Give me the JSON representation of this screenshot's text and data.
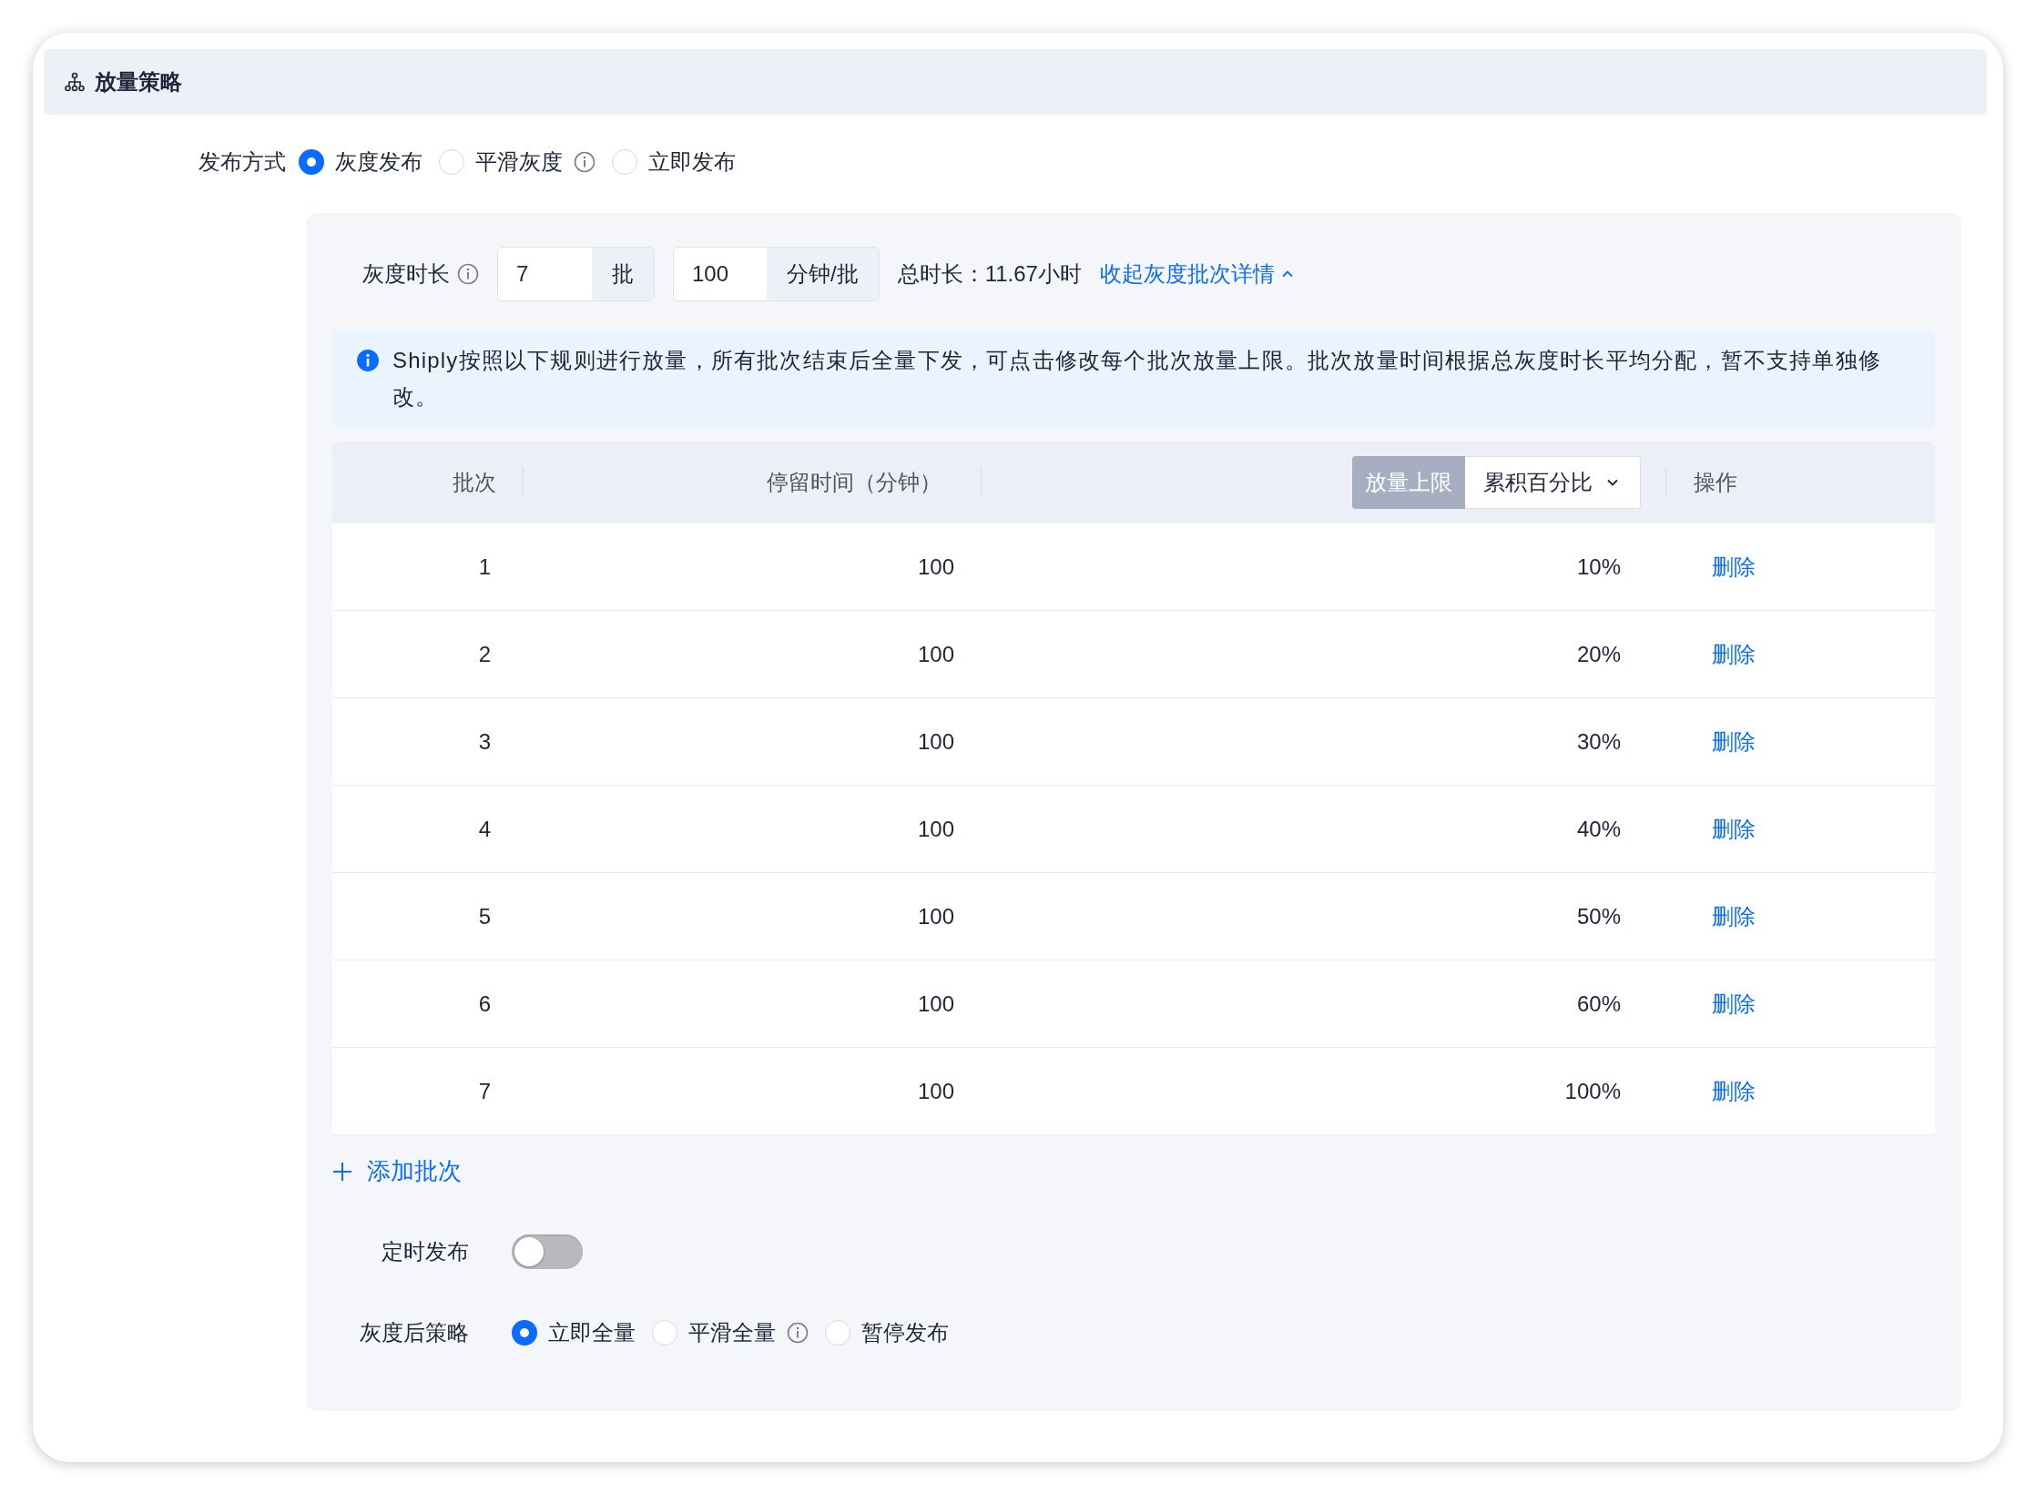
{
  "section": {
    "title": "放量策略"
  },
  "release_mode": {
    "label": "发布方式",
    "options": [
      {
        "label": "灰度发布",
        "selected": true,
        "info": false
      },
      {
        "label": "平滑灰度",
        "selected": false,
        "info": true
      },
      {
        "label": "立即发布",
        "selected": false,
        "info": false
      }
    ]
  },
  "duration": {
    "label": "灰度时长",
    "batches": {
      "value": "7",
      "unit": "批"
    },
    "minutes": {
      "value": "100",
      "unit": "分钟/批"
    },
    "total": "总时长：11.67小时",
    "toggle_link": "收起灰度批次详情"
  },
  "notice": "Shiply按照以下规则进行放量，所有批次结束后全量下发，可点击修改每个批次放量上限。批次放量时间根据总灰度时长平均分配，暂不支持单独修改。",
  "table": {
    "columns": [
      "批次",
      "停留时间（分钟）"
    ],
    "limit_header": {
      "tag": "放量上限",
      "select": "累积百分比"
    },
    "action_column": "操作",
    "rows": [
      {
        "batch": "1",
        "minutes": "100",
        "limit": "10%",
        "action": "删除"
      },
      {
        "batch": "2",
        "minutes": "100",
        "limit": "20%",
        "action": "删除"
      },
      {
        "batch": "3",
        "minutes": "100",
        "limit": "30%",
        "action": "删除"
      },
      {
        "batch": "4",
        "minutes": "100",
        "limit": "40%",
        "action": "删除"
      },
      {
        "batch": "5",
        "minutes": "100",
        "limit": "50%",
        "action": "删除"
      },
      {
        "batch": "6",
        "minutes": "100",
        "limit": "60%",
        "action": "删除"
      },
      {
        "batch": "7",
        "minutes": "100",
        "limit": "100%",
        "action": "删除"
      }
    ]
  },
  "add_batch": "添加批次",
  "schedule": {
    "label": "定时发布",
    "on": false
  },
  "after_strategy": {
    "label": "灰度后策略",
    "options": [
      {
        "label": "立即全量",
        "selected": true,
        "info": false
      },
      {
        "label": "平滑全量",
        "selected": false,
        "info": true
      },
      {
        "label": "暂停发布",
        "selected": false,
        "info": false
      }
    ]
  }
}
